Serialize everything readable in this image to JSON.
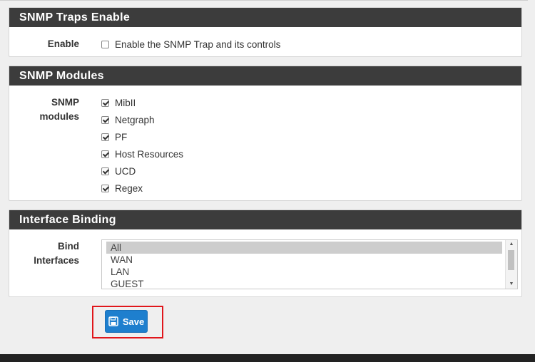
{
  "sections": {
    "traps": {
      "title": "SNMP Traps Enable",
      "enable_label": "Enable",
      "enable_text": "Enable the SNMP Trap and its controls",
      "enable_checked": false
    },
    "modules": {
      "title": "SNMP Modules",
      "label_line1": "SNMP",
      "label_line2": "modules",
      "items": [
        {
          "label": "MibII",
          "checked": true
        },
        {
          "label": "Netgraph",
          "checked": true
        },
        {
          "label": "PF",
          "checked": true
        },
        {
          "label": "Host Resources",
          "checked": true
        },
        {
          "label": "UCD",
          "checked": true
        },
        {
          "label": "Regex",
          "checked": true
        }
      ]
    },
    "binding": {
      "title": "Interface Binding",
      "label_line1": "Bind",
      "label_line2": "Interfaces",
      "options": [
        "All",
        "WAN",
        "LAN",
        "GUEST"
      ],
      "selected": "All"
    }
  },
  "actions": {
    "save_label": "Save"
  },
  "colors": {
    "panel_header": "#3c3c3c",
    "save_button": "#1e7fce",
    "highlight": "#e0161b"
  }
}
